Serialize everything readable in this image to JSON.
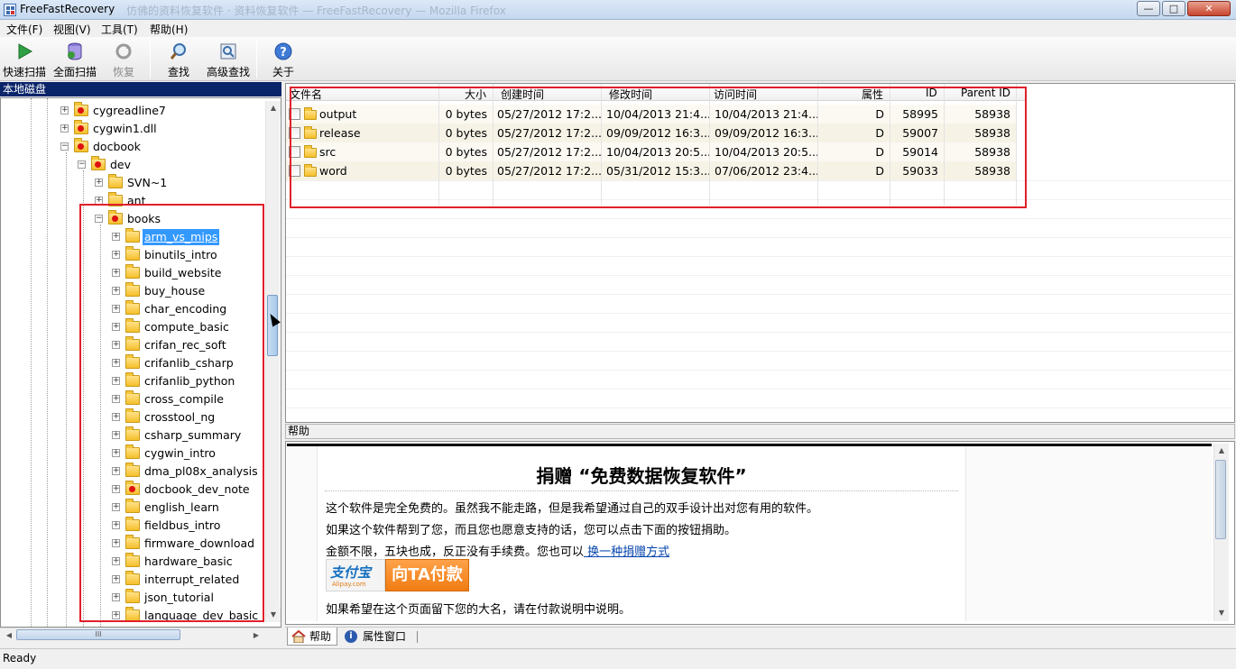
{
  "window": {
    "title": "FreeFastRecovery",
    "title_suffix": "仿佛的资料恢复软件 · 资料恢复软件 — FreeFastRecovery — Mozilla Firefox",
    "minimize": "—",
    "maximize": "□",
    "close": "✕"
  },
  "menu": [
    "文件(F)",
    "视图(V)",
    "工具(T)",
    "帮助(H)"
  ],
  "toolbar": {
    "quick_scan": "快速扫描",
    "full_scan": "全面扫描",
    "recover": "恢复",
    "find": "查找",
    "advanced_find": "高级查找",
    "about": "关于"
  },
  "left_panel": {
    "header": "本地磁盘",
    "tree": [
      {
        "label": "cygreadline7",
        "level": 3,
        "icon": "special"
      },
      {
        "label": "cygwin1.dll",
        "level": 3,
        "icon": "special"
      },
      {
        "label": "docbook",
        "level": 3,
        "icon": "special",
        "expanded": true
      },
      {
        "label": "dev",
        "level": 4,
        "icon": "special",
        "expanded": true
      },
      {
        "label": "SVN~1",
        "level": 5,
        "icon": "folder"
      },
      {
        "label": "ant",
        "level": 5,
        "icon": "folder"
      },
      {
        "label": "books",
        "level": 5,
        "icon": "special",
        "expanded": true
      },
      {
        "label": "arm_vs_mips",
        "level": 6,
        "icon": "folder",
        "selected": true
      },
      {
        "label": "binutils_intro",
        "level": 6,
        "icon": "folder"
      },
      {
        "label": "build_website",
        "level": 6,
        "icon": "folder"
      },
      {
        "label": "buy_house",
        "level": 6,
        "icon": "folder"
      },
      {
        "label": "char_encoding",
        "level": 6,
        "icon": "folder"
      },
      {
        "label": "compute_basic",
        "level": 6,
        "icon": "folder"
      },
      {
        "label": "crifan_rec_soft",
        "level": 6,
        "icon": "folder"
      },
      {
        "label": "crifanlib_csharp",
        "level": 6,
        "icon": "folder"
      },
      {
        "label": "crifanlib_python",
        "level": 6,
        "icon": "folder"
      },
      {
        "label": "cross_compile",
        "level": 6,
        "icon": "folder"
      },
      {
        "label": "crosstool_ng",
        "level": 6,
        "icon": "folder"
      },
      {
        "label": "csharp_summary",
        "level": 6,
        "icon": "folder"
      },
      {
        "label": "cygwin_intro",
        "level": 6,
        "icon": "folder"
      },
      {
        "label": "dma_pl08x_analysis",
        "level": 6,
        "icon": "folder"
      },
      {
        "label": "docbook_dev_note",
        "level": 6,
        "icon": "special"
      },
      {
        "label": "english_learn",
        "level": 6,
        "icon": "folder"
      },
      {
        "label": "fieldbus_intro",
        "level": 6,
        "icon": "folder"
      },
      {
        "label": "firmware_download",
        "level": 6,
        "icon": "folder"
      },
      {
        "label": "hardware_basic",
        "level": 6,
        "icon": "folder"
      },
      {
        "label": "interrupt_related",
        "level": 6,
        "icon": "folder"
      },
      {
        "label": "json_tutorial",
        "level": 6,
        "icon": "folder"
      },
      {
        "label": "language_dev_basic",
        "level": 6,
        "icon": "folder"
      }
    ],
    "hscroll_grip": "III"
  },
  "file_list": {
    "columns": [
      "文件名",
      "大小",
      "创建时间",
      "修改时间",
      "访问时间",
      "属性",
      "ID",
      "Parent ID"
    ],
    "rows": [
      {
        "name": "output",
        "size": "0 bytes",
        "created": "05/27/2012 17:2...",
        "modified": "10/04/2013 21:4...",
        "accessed": "10/04/2013 21:4...",
        "attr": "D",
        "id": "58995",
        "parent_id": "58938"
      },
      {
        "name": "release",
        "size": "0 bytes",
        "created": "05/27/2012 17:2...",
        "modified": "09/09/2012 16:3...",
        "accessed": "09/09/2012 16:3...",
        "attr": "D",
        "id": "59007",
        "parent_id": "58938"
      },
      {
        "name": "src",
        "size": "0 bytes",
        "created": "05/27/2012 17:2...",
        "modified": "10/04/2013 20:5...",
        "accessed": "10/04/2013 20:5...",
        "attr": "D",
        "id": "59014",
        "parent_id": "58938"
      },
      {
        "name": "word",
        "size": "0 bytes",
        "created": "05/27/2012 17:2...",
        "modified": "05/31/2012 15:3...",
        "accessed": "07/06/2012 23:4...",
        "attr": "D",
        "id": "59033",
        "parent_id": "58938"
      }
    ]
  },
  "help_panel": {
    "header": "帮助",
    "title": "捐赠 “免费数据恢复软件”",
    "line1": "这个软件是完全免费的。虽然我不能走路，但是我希望通过自己的双手设计出对您有用的软件。",
    "line2": "如果这个软件帮到了您，而且您也愿意支持的话，您可以点击下面的按钮捐助。",
    "line3": "金额不限，五块也成，反正没有手续费。您也可以",
    "line3_link": " 换一种捐赠方式",
    "alipay_logo": "支付宝",
    "alipay_sub": "Alipay.com",
    "pay_button": "向TA付款",
    "line4": "如果希望在这个页面留下您的大名，请在付款说明中说明。"
  },
  "tabs": {
    "help": "帮助",
    "properties": "属性窗口"
  },
  "status": "Ready",
  "colors": {
    "highlight_box": "#e0202a",
    "selection": "#3399ff",
    "panel_header": "#0a246a"
  }
}
